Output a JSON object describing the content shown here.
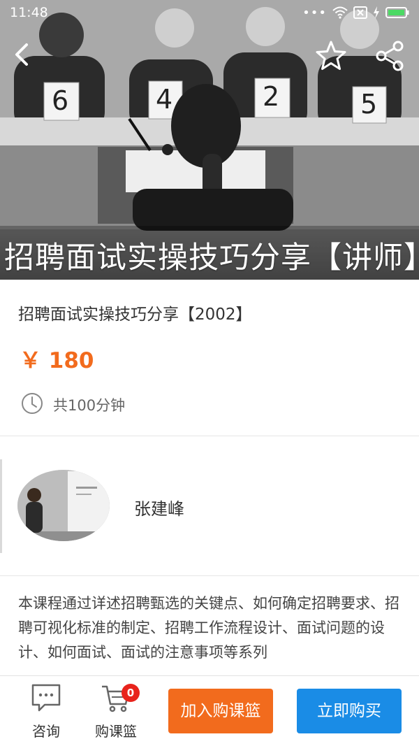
{
  "status_bar": {
    "time": "11:48"
  },
  "hero": {
    "banner_text": "招聘面试实操技巧分享【讲师】",
    "placards": [
      "6",
      "4",
      "2",
      "5"
    ]
  },
  "course": {
    "title": "招聘面试实操技巧分享【2002】",
    "price": "￥ 180",
    "duration": "共100分钟"
  },
  "teacher": {
    "name": "张建峰"
  },
  "description": "本课程通过详述招聘甄选的关键点、如何确定招聘要求、招聘可视化标准的制定、招聘工作流程设计、面试问题的设计、如何面试、面试的注意事项等系列",
  "bottom_bar": {
    "consult_label": "咨询",
    "basket_label": "购课篮",
    "basket_count": "0",
    "add_to_basket_label": "加入购课篮",
    "buy_now_label": "立即购买"
  },
  "colors": {
    "price": "#f26b1d",
    "add_button": "#f26b1d",
    "buy_button": "#1a8ce6",
    "badge": "#e8231c"
  },
  "icons": [
    "back-icon",
    "star-icon",
    "share-icon",
    "clock-icon",
    "chat-icon",
    "cart-icon",
    "wifi-icon",
    "battery-icon"
  ]
}
